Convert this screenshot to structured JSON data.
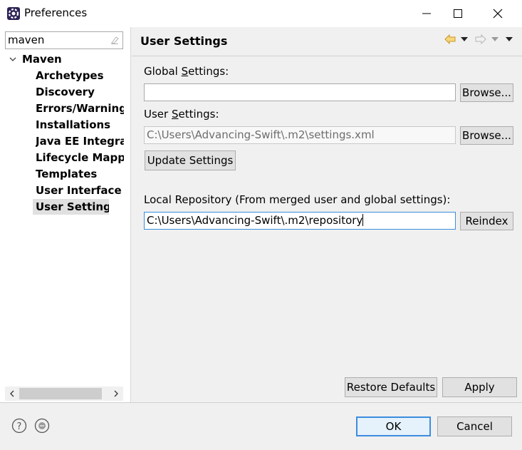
{
  "window": {
    "title": "Preferences",
    "app_icon": "eclipse-gear-icon"
  },
  "filter": {
    "value": "maven"
  },
  "tree": {
    "root_label": "Maven",
    "items": [
      {
        "label": "Archetypes"
      },
      {
        "label": "Discovery"
      },
      {
        "label": "Errors/Warnings"
      },
      {
        "label": "Installations"
      },
      {
        "label": "Java EE Integrati"
      },
      {
        "label": "Lifecycle Mappir"
      },
      {
        "label": "Templates"
      },
      {
        "label": "User Interface"
      },
      {
        "label": "User Settings",
        "selected": true
      }
    ]
  },
  "page": {
    "title": "User Settings",
    "global_settings": {
      "label_pre": "Global ",
      "label_mnemonic": "S",
      "label_post": "ettings:",
      "value": "",
      "browse_label": "Browse..."
    },
    "user_settings": {
      "label_pre": "User ",
      "label_mnemonic": "S",
      "label_post": "ettings:",
      "value": "C:\\Users\\Advancing-Swift\\.m2\\settings.xml",
      "browse_label": "Browse..."
    },
    "update_settings_label": "Update Settings",
    "local_repository": {
      "label": "Local Repository (From merged user and global settings):",
      "value": "C:\\Users\\Advancing-Swift\\.m2\\repository",
      "reindex_label": "Reindex"
    },
    "restore_defaults_label": "Restore Defaults",
    "apply_label": "Apply"
  },
  "footer": {
    "ok_label": "OK",
    "cancel_label": "Cancel"
  },
  "colors": {
    "accent": "#3b8de0",
    "nav_back": "#e8b84a",
    "selection": "#e0e0e0"
  }
}
